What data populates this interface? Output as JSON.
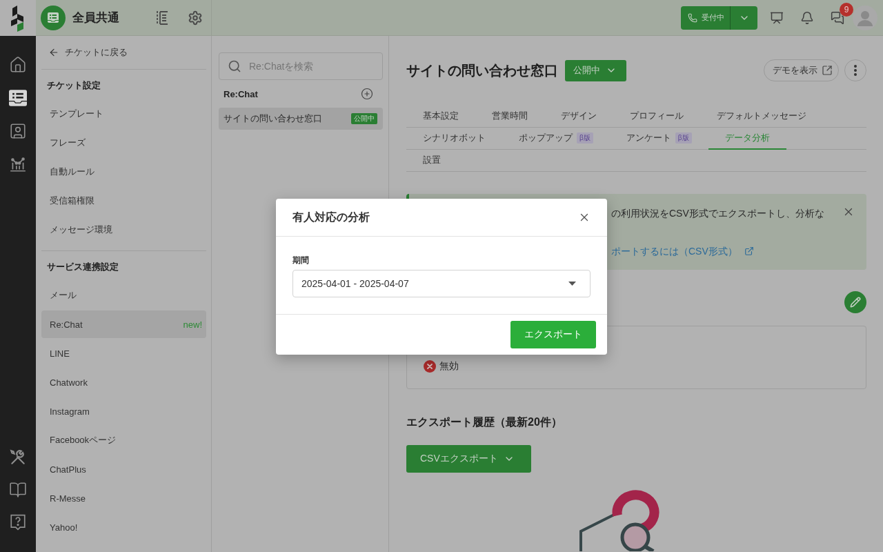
{
  "top_bar": {
    "workspace": {
      "title": "全員共通"
    },
    "reception_button": {
      "label": "受付中"
    },
    "chat": {
      "badge": "9"
    }
  },
  "rail": {
    "top": [
      {
        "kind": "home",
        "selected": false
      },
      {
        "kind": "tickets",
        "selected": true
      },
      {
        "kind": "contacts",
        "selected": false
      },
      {
        "kind": "analytics",
        "selected": false
      }
    ],
    "bottom": [
      {
        "kind": "tools",
        "selected": false
      },
      {
        "kind": "guide",
        "selected": false
      },
      {
        "kind": "help",
        "selected": false
      }
    ]
  },
  "settings_sidebar": {
    "back_link": "チケットに戻る",
    "sections": [
      {
        "heading": "チケット設定",
        "items": [
          {
            "label": "テンプレート",
            "selected": false
          },
          {
            "label": "フレーズ",
            "selected": false
          },
          {
            "label": "自動ルール",
            "selected": false
          },
          {
            "label": "受信箱権限",
            "selected": false
          },
          {
            "label": "メッセージ環境",
            "selected": false
          }
        ]
      },
      {
        "heading": "サービス連携設定",
        "items": [
          {
            "label": "メール",
            "selected": false
          },
          {
            "label": "Re:Chat",
            "selected": true,
            "badge": "new!"
          },
          {
            "label": "LINE",
            "selected": false
          },
          {
            "label": "Chatwork",
            "selected": false
          },
          {
            "label": "Instagram",
            "selected": false
          },
          {
            "label": "Facebookページ",
            "selected": false
          },
          {
            "label": "ChatPlus",
            "selected": false
          },
          {
            "label": "R-Messe",
            "selected": false
          },
          {
            "label": "Yahoo!",
            "selected": false
          }
        ]
      }
    ]
  },
  "channel_list": {
    "search": {
      "placeholder": "Re:Chatを検索"
    },
    "heading": "Re:Chat",
    "items": [
      {
        "label": "サイトの問い合わせ窓口",
        "badge": "公開中",
        "selected": true
      }
    ]
  },
  "main": {
    "title": "サイトの問い合わせ窓口",
    "status_button": "公開中",
    "demo_button": "デモを表示",
    "tab_rows": [
      {
        "tabs": [
          {
            "label": "基本設定",
            "selected": false
          },
          {
            "label": "営業時間",
            "selected": false
          },
          {
            "label": "デザイン",
            "selected": false
          },
          {
            "label": "プロフィール",
            "selected": false
          },
          {
            "label": "デフォルトメッセージ",
            "selected": false
          }
        ]
      },
      {
        "tabs": [
          {
            "label": "シナリオボット",
            "selected": false
          },
          {
            "label": "ポップアップ",
            "badge": "β版",
            "selected": false
          },
          {
            "label": "アンケート",
            "badge": "β版",
            "selected": false
          },
          {
            "label": "データ分析",
            "selected": true
          }
        ]
      },
      {
        "tabs": [
          {
            "label": "設置",
            "selected": false
          }
        ]
      }
    ],
    "banner": {
      "text": "の利用状況をCSV形式でエクスポートし、分析な",
      "link": "ポートするには（CSV形式）"
    },
    "settings_box": {
      "status": {
        "kind": "disabled",
        "label": "無効"
      }
    },
    "history": {
      "heading": "エクスポート履歴（最新20件）",
      "export_button": "CSVエクスポート"
    }
  },
  "dialog": {
    "title": "有人対応の分析",
    "field": {
      "label": "期間",
      "value": "2025-04-01 - 2025-04-07"
    },
    "export_button": "エクスポート"
  }
}
